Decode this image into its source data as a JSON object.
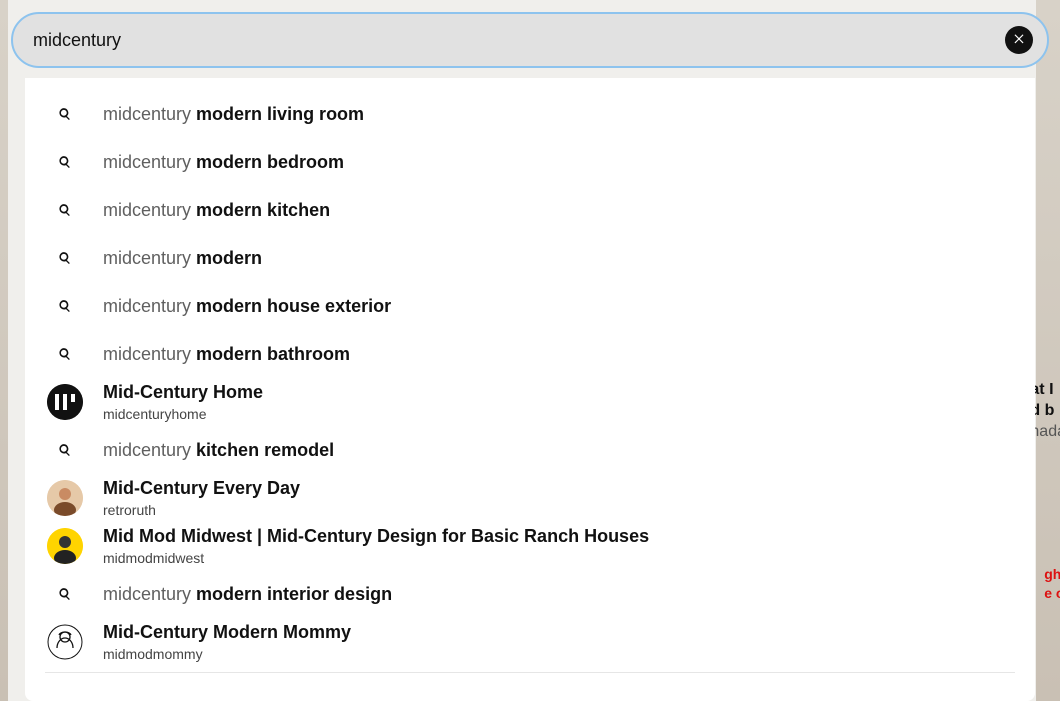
{
  "search": {
    "value": "midcentury"
  },
  "suggestions": [
    {
      "type": "search",
      "prefix": "midcentury ",
      "suffix": "modern living room"
    },
    {
      "type": "search",
      "prefix": "midcentury ",
      "suffix": "modern bedroom"
    },
    {
      "type": "search",
      "prefix": "midcentury ",
      "suffix": "modern kitchen"
    },
    {
      "type": "search",
      "prefix": "midcentury ",
      "suffix": "modern"
    },
    {
      "type": "search",
      "prefix": "midcentury ",
      "suffix": "modern house exterior"
    },
    {
      "type": "search",
      "prefix": "midcentury ",
      "suffix": "modern bathroom"
    },
    {
      "type": "profile",
      "title": "Mid-Century Home",
      "handle": "midcenturyhome",
      "avatar": "mch"
    },
    {
      "type": "search",
      "prefix": "midcentury ",
      "suffix": "kitchen remodel"
    },
    {
      "type": "profile",
      "title": "Mid-Century Every Day",
      "handle": "retroruth",
      "avatar": "retro"
    },
    {
      "type": "profile",
      "title": "Mid Mod Midwest | Mid-Century Design for Basic Ranch Houses",
      "handle": "midmodmidwest",
      "avatar": "midwest"
    },
    {
      "type": "search",
      "prefix": "midcentury ",
      "suffix": "modern interior design"
    },
    {
      "type": "profile",
      "title": "Mid-Century Modern Mommy",
      "handle": "midmodmommy",
      "avatar": "mommy"
    }
  ],
  "bg": {
    "line1": "at I",
    "line2": "d b",
    "line3": "nada",
    "red1": "ght",
    "red2": "e o"
  },
  "avatars": {
    "mch": {
      "bg": "#111",
      "kind": "mch"
    },
    "retro": {
      "bg": "#e6c9a8",
      "kind": "photo"
    },
    "midwest": {
      "bg": "#ffd400",
      "kind": "photo2"
    },
    "mommy": {
      "bg": "#ffffff",
      "kind": "sketch"
    }
  }
}
